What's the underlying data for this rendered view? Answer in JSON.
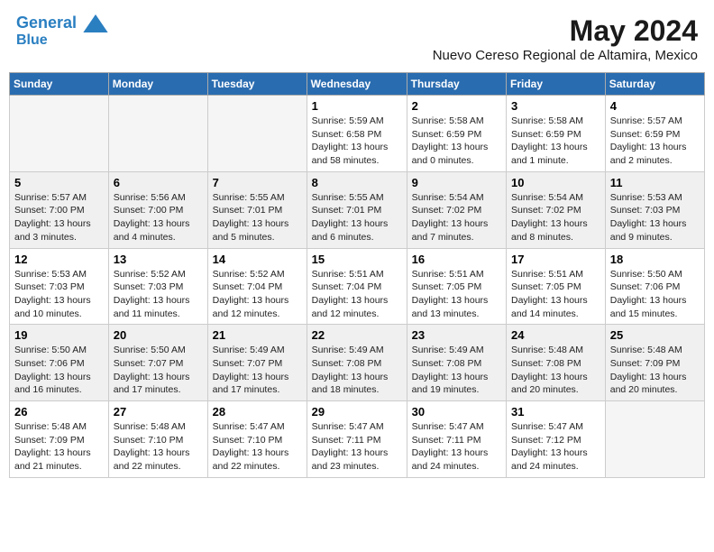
{
  "header": {
    "logo_line1": "General",
    "logo_line2": "Blue",
    "month": "May 2024",
    "location": "Nuevo Cereso Regional de Altamira, Mexico"
  },
  "days_of_week": [
    "Sunday",
    "Monday",
    "Tuesday",
    "Wednesday",
    "Thursday",
    "Friday",
    "Saturday"
  ],
  "weeks": [
    [
      {
        "day": "",
        "info": ""
      },
      {
        "day": "",
        "info": ""
      },
      {
        "day": "",
        "info": ""
      },
      {
        "day": "1",
        "info": "Sunrise: 5:59 AM\nSunset: 6:58 PM\nDaylight: 13 hours\nand 58 minutes."
      },
      {
        "day": "2",
        "info": "Sunrise: 5:58 AM\nSunset: 6:59 PM\nDaylight: 13 hours\nand 0 minutes."
      },
      {
        "day": "3",
        "info": "Sunrise: 5:58 AM\nSunset: 6:59 PM\nDaylight: 13 hours\nand 1 minute."
      },
      {
        "day": "4",
        "info": "Sunrise: 5:57 AM\nSunset: 6:59 PM\nDaylight: 13 hours\nand 2 minutes."
      }
    ],
    [
      {
        "day": "5",
        "info": "Sunrise: 5:57 AM\nSunset: 7:00 PM\nDaylight: 13 hours\nand 3 minutes."
      },
      {
        "day": "6",
        "info": "Sunrise: 5:56 AM\nSunset: 7:00 PM\nDaylight: 13 hours\nand 4 minutes."
      },
      {
        "day": "7",
        "info": "Sunrise: 5:55 AM\nSunset: 7:01 PM\nDaylight: 13 hours\nand 5 minutes."
      },
      {
        "day": "8",
        "info": "Sunrise: 5:55 AM\nSunset: 7:01 PM\nDaylight: 13 hours\nand 6 minutes."
      },
      {
        "day": "9",
        "info": "Sunrise: 5:54 AM\nSunset: 7:02 PM\nDaylight: 13 hours\nand 7 minutes."
      },
      {
        "day": "10",
        "info": "Sunrise: 5:54 AM\nSunset: 7:02 PM\nDaylight: 13 hours\nand 8 minutes."
      },
      {
        "day": "11",
        "info": "Sunrise: 5:53 AM\nSunset: 7:03 PM\nDaylight: 13 hours\nand 9 minutes."
      }
    ],
    [
      {
        "day": "12",
        "info": "Sunrise: 5:53 AM\nSunset: 7:03 PM\nDaylight: 13 hours\nand 10 minutes."
      },
      {
        "day": "13",
        "info": "Sunrise: 5:52 AM\nSunset: 7:03 PM\nDaylight: 13 hours\nand 11 minutes."
      },
      {
        "day": "14",
        "info": "Sunrise: 5:52 AM\nSunset: 7:04 PM\nDaylight: 13 hours\nand 12 minutes."
      },
      {
        "day": "15",
        "info": "Sunrise: 5:51 AM\nSunset: 7:04 PM\nDaylight: 13 hours\nand 12 minutes."
      },
      {
        "day": "16",
        "info": "Sunrise: 5:51 AM\nSunset: 7:05 PM\nDaylight: 13 hours\nand 13 minutes."
      },
      {
        "day": "17",
        "info": "Sunrise: 5:51 AM\nSunset: 7:05 PM\nDaylight: 13 hours\nand 14 minutes."
      },
      {
        "day": "18",
        "info": "Sunrise: 5:50 AM\nSunset: 7:06 PM\nDaylight: 13 hours\nand 15 minutes."
      }
    ],
    [
      {
        "day": "19",
        "info": "Sunrise: 5:50 AM\nSunset: 7:06 PM\nDaylight: 13 hours\nand 16 minutes."
      },
      {
        "day": "20",
        "info": "Sunrise: 5:50 AM\nSunset: 7:07 PM\nDaylight: 13 hours\nand 17 minutes."
      },
      {
        "day": "21",
        "info": "Sunrise: 5:49 AM\nSunset: 7:07 PM\nDaylight: 13 hours\nand 17 minutes."
      },
      {
        "day": "22",
        "info": "Sunrise: 5:49 AM\nSunset: 7:08 PM\nDaylight: 13 hours\nand 18 minutes."
      },
      {
        "day": "23",
        "info": "Sunrise: 5:49 AM\nSunset: 7:08 PM\nDaylight: 13 hours\nand 19 minutes."
      },
      {
        "day": "24",
        "info": "Sunrise: 5:48 AM\nSunset: 7:08 PM\nDaylight: 13 hours\nand 20 minutes."
      },
      {
        "day": "25",
        "info": "Sunrise: 5:48 AM\nSunset: 7:09 PM\nDaylight: 13 hours\nand 20 minutes."
      }
    ],
    [
      {
        "day": "26",
        "info": "Sunrise: 5:48 AM\nSunset: 7:09 PM\nDaylight: 13 hours\nand 21 minutes."
      },
      {
        "day": "27",
        "info": "Sunrise: 5:48 AM\nSunset: 7:10 PM\nDaylight: 13 hours\nand 22 minutes."
      },
      {
        "day": "28",
        "info": "Sunrise: 5:47 AM\nSunset: 7:10 PM\nDaylight: 13 hours\nand 22 minutes."
      },
      {
        "day": "29",
        "info": "Sunrise: 5:47 AM\nSunset: 7:11 PM\nDaylight: 13 hours\nand 23 minutes."
      },
      {
        "day": "30",
        "info": "Sunrise: 5:47 AM\nSunset: 7:11 PM\nDaylight: 13 hours\nand 24 minutes."
      },
      {
        "day": "31",
        "info": "Sunrise: 5:47 AM\nSunset: 7:12 PM\nDaylight: 13 hours\nand 24 minutes."
      },
      {
        "day": "",
        "info": ""
      }
    ]
  ]
}
